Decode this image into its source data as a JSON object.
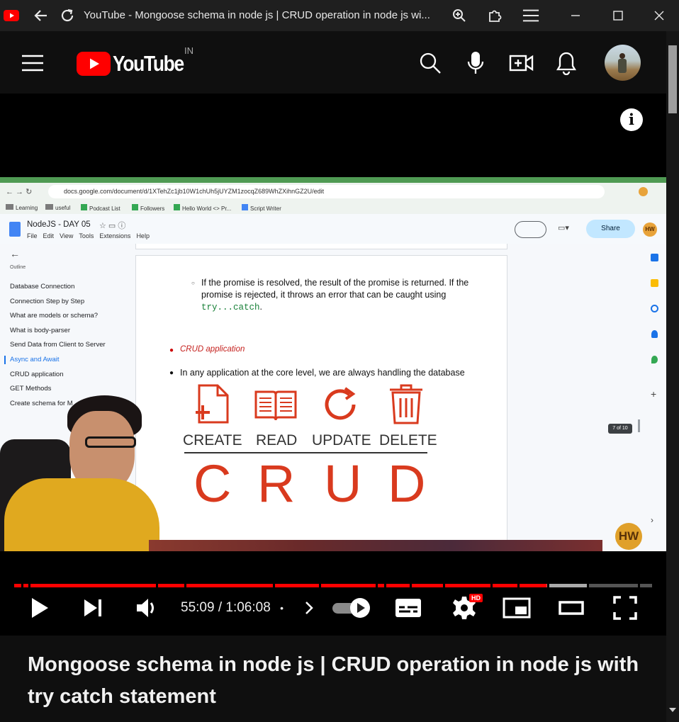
{
  "browser": {
    "tab_title": "YouTube - Mongoose schema in node js | CRUD operation in node js wi..."
  },
  "youtube": {
    "logo_text": "YouTube",
    "region": "IN"
  },
  "inner_browser": {
    "url": "docs.google.com/document/d/1XTehZc1jb10W1chUh5jUYZM1zocqZ689WhZXihnGZ2U/edit",
    "bookmarks": [
      "Learning",
      "useful",
      "Podcast List",
      "Followers",
      "Hello World <> Pr...",
      "Script Writer"
    ],
    "doc_title": "NodeJS - DAY 05",
    "menu": [
      "File",
      "Edit",
      "View",
      "Tools",
      "Extensions",
      "Help"
    ],
    "share_label": "Share",
    "avatar_initials": "HW",
    "outline_label": "Outline",
    "outline": [
      "Database Connection",
      "Connection Step by Step",
      "What are models or schema?",
      "What is body-parser",
      "Send Data from Client to Server",
      "Async and Await",
      "CRUD application",
      "GET Methods",
      "Create schema for M"
    ],
    "outline_active_index": 5,
    "doc_para_1": "If the promise is resolved, the result of the promise is returned. If the promise is rejected, it throws an error that can be caught using",
    "doc_code": "try...catch",
    "doc_period": ".",
    "doc_heading": "CRUD application",
    "doc_para_2": "In any application at the core level, we are always handling the database",
    "crud_labels": [
      "CREATE",
      "READ",
      "UPDATE",
      "DELETE"
    ],
    "crud_letters": [
      "C",
      "R",
      "U",
      "D"
    ],
    "page_indicator": "7 of 10",
    "watermark": "HW"
  },
  "player": {
    "current_time": "55:09",
    "separator": " / ",
    "duration": "1:06:08",
    "bullet": "•",
    "progress_fraction": 0.835,
    "quality_badge": "HD",
    "accent": "#ff0000"
  },
  "video_title": "Mongoose schema in node js | CRUD operation in node js with try catch statement"
}
